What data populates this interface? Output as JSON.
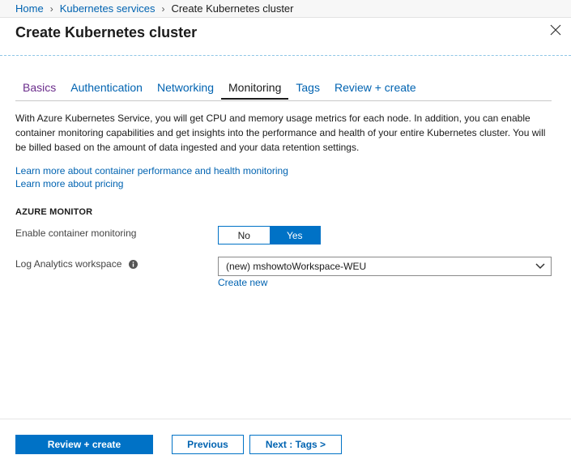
{
  "breadcrumb": {
    "home": "Home",
    "services": "Kubernetes services",
    "current": "Create Kubernetes cluster"
  },
  "blade": {
    "title": "Create Kubernetes cluster"
  },
  "tabs": [
    {
      "label": "Basics",
      "state": "visited"
    },
    {
      "label": "Authentication",
      "state": "link"
    },
    {
      "label": "Networking",
      "state": "link"
    },
    {
      "label": "Monitoring",
      "state": "active"
    },
    {
      "label": "Tags",
      "state": "link"
    },
    {
      "label": "Review + create",
      "state": "link"
    }
  ],
  "description": "With Azure Kubernetes Service, you will get CPU and memory usage metrics for each node. In addition, you can enable container monitoring capabilities and get insights into the performance and health of your entire Kubernetes cluster. You will be billed based on the amount of data ingested and your data retention settings.",
  "links": {
    "learn_monitoring": "Learn more about container performance and health monitoring",
    "learn_pricing": "Learn more about pricing"
  },
  "azure_monitor": {
    "section_title": "AZURE MONITOR",
    "enable_label": "Enable container monitoring",
    "toggle_no": "No",
    "toggle_yes": "Yes",
    "selected": "Yes",
    "workspace_label": "Log Analytics workspace",
    "workspace_value": "(new) mshowtoWorkspace-WEU",
    "create_new": "Create new"
  },
  "footer": {
    "review_create": "Review + create",
    "previous": "Previous",
    "next": "Next : Tags >"
  },
  "colors": {
    "accent": "#0072c6",
    "link": "#0063b1",
    "visited": "#6b2d8c"
  }
}
